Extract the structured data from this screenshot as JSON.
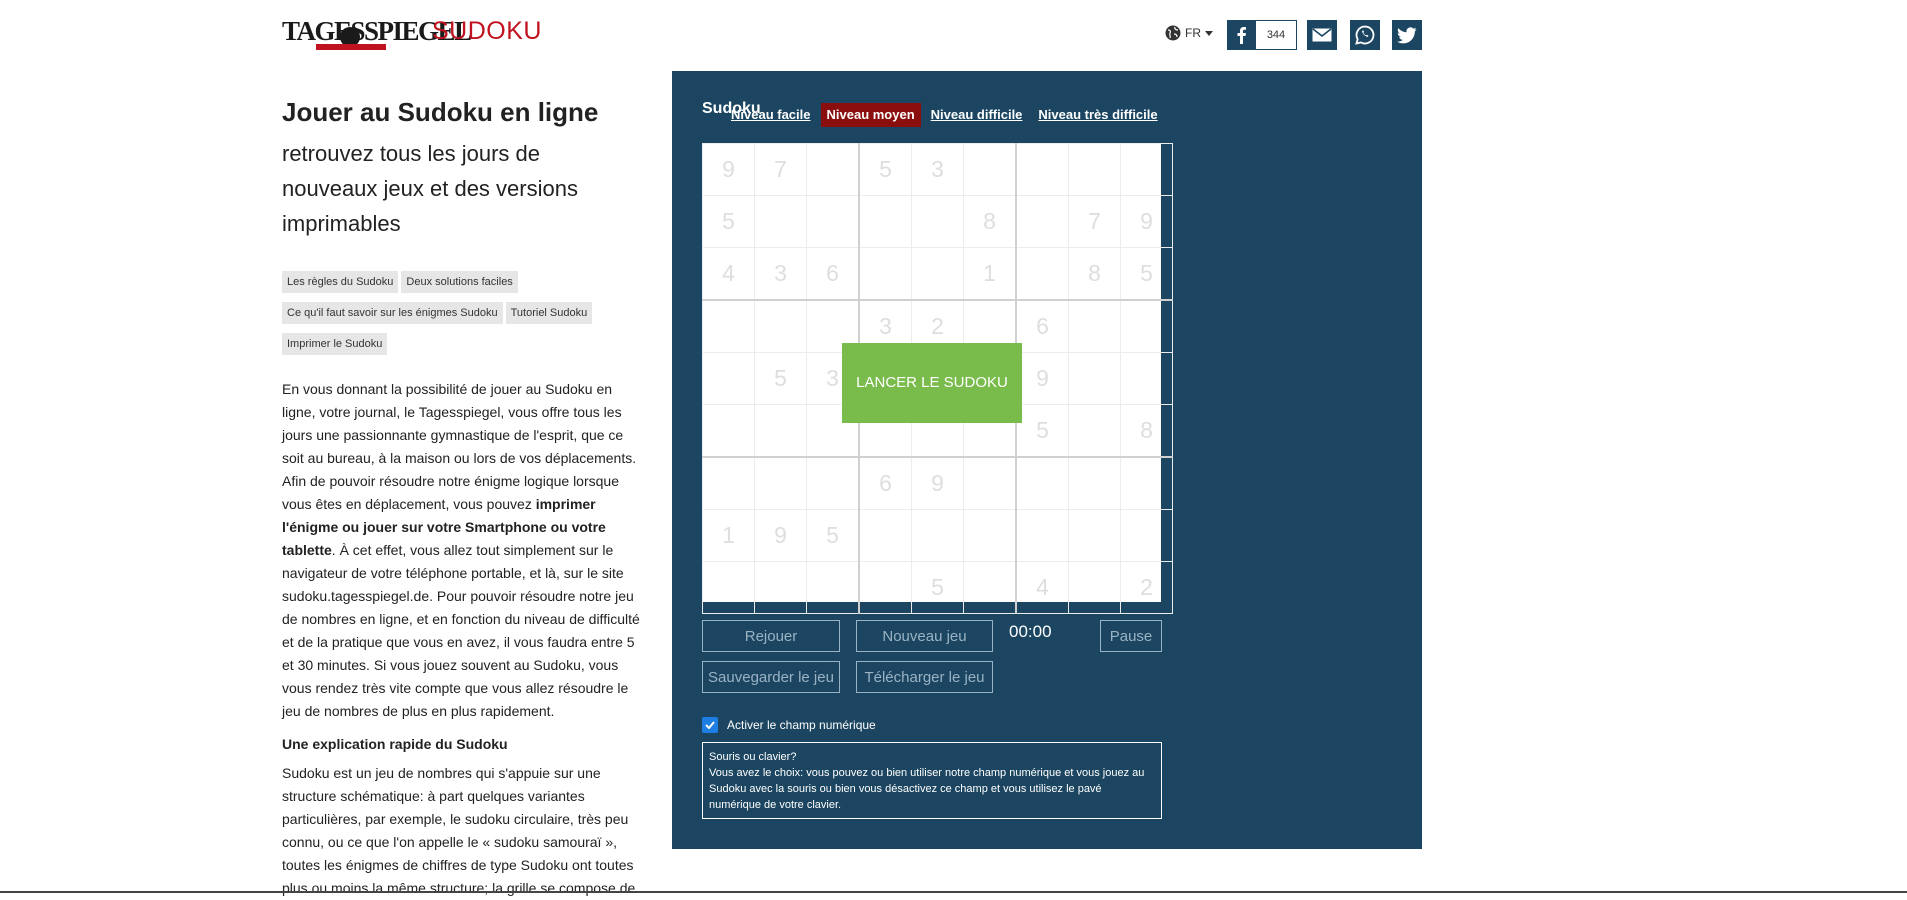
{
  "header": {
    "logo_main": "TAGESSPIEGEL",
    "logo_sub": "SUDOKU",
    "language": "FR",
    "facebook_count": "344"
  },
  "intro": {
    "title": "Jouer au Sudoku en ligne",
    "subtitle": "retrouvez tous les jours de nouveaux jeux et des versions imprimables"
  },
  "tags": [
    "Les règles du Sudoku",
    "Deux solutions faciles",
    "Ce qu'il faut savoir sur les énigmes Sudoku",
    "Tutoriel Sudoku",
    "Imprimer le Sudoku"
  ],
  "article": {
    "p1_a": "En vous donnant la possibilité de jouer au Sudoku en ligne, votre journal, le Tagesspiegel, vous offre tous les jours une passionnante gymnastique de l'esprit, que ce soit au bureau, à la maison ou lors de vos déplacements. Afin de pouvoir résoudre notre énigme logique lorsque vous êtes en déplacement, vous pouvez ",
    "p1_bold": "imprimer l'énigme ou jouer sur votre Smartphone ou votre tablette",
    "p1_b": ". À cet effet, vous allez tout simplement sur le navigateur de votre téléphone portable, et là, sur le site sudoku.tagesspiegel.de. Pour pouvoir résoudre notre jeu de nombres en ligne, et en fonction du niveau de difficulté et de la pratique que vous en avez, il vous faudra entre 5 et 30 minutes. Si vous jouez souvent au Sudoku, vous vous rendez très vite compte que vous allez résoudre le jeu de nombres de plus en plus rapidement.",
    "section_title": "Une explication rapide du Sudoku",
    "p2": "Sudoku est un jeu de nombres qui s'appuie sur une structure schématique: à part quelques variantes particulières, par exemple, le sudoku circulaire, très peu connu, ou ce que l'on appelle le « sudoku samouraï », toutes les énigmes de chiffres de type Sudoku ont toutes plus ou moins la même structure; la grille se compose de"
  },
  "game": {
    "title": "Sudoku",
    "levels": [
      "Niveau facile",
      "Niveau moyen",
      "Niveau difficile",
      "Niveau très difficile"
    ],
    "active_level": "Niveau moyen",
    "grid": [
      [
        "9",
        "7",
        "",
        "5",
        "3",
        "",
        "",
        "",
        ""
      ],
      [
        "5",
        "",
        "",
        "",
        "",
        "8",
        "",
        "7",
        "9"
      ],
      [
        "4",
        "3",
        "6",
        "",
        "",
        "1",
        "",
        "8",
        "5"
      ],
      [
        "",
        "",
        "",
        "3",
        "2",
        "",
        "6",
        "",
        ""
      ],
      [
        "",
        "5",
        "3",
        "",
        "",
        "",
        "9",
        "",
        ""
      ],
      [
        "",
        "",
        "",
        "",
        "",
        "",
        "5",
        "",
        "8"
      ],
      [
        "",
        "",
        "",
        "6",
        "9",
        "",
        "",
        "",
        ""
      ],
      [
        "1",
        "9",
        "5",
        "",
        "",
        "",
        "",
        "",
        ""
      ],
      [
        "",
        "",
        "",
        "",
        "5",
        "",
        "4",
        "",
        "2"
      ]
    ],
    "launch_label": "LANCER LE SUDOKU",
    "buttons": {
      "replay": "Rejouer",
      "new_game": "Nouveau jeu",
      "pause": "Pause",
      "save": "Sauvegarder le jeu",
      "download": "Télécharger le jeu"
    },
    "timer": "00:00",
    "numpad_label": "Activer le champ numérique",
    "numpad_checked": true,
    "info_title": "Souris ou clavier?",
    "info_text": "Vous avez le choix: vous pouvez ou bien utiliser notre champ numérique et vous jouez au Sudoku avec la souris ou bien vous désactivez ce champ et vous utilisez le pavé numérique de votre clavier."
  },
  "colors": {
    "panel": "#1b4560",
    "active_level": "#8b0e0e",
    "launch_button": "#79bc4b",
    "brand_red": "#c1121f"
  }
}
